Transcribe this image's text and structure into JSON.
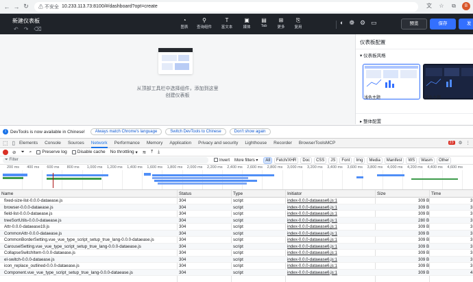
{
  "browser": {
    "security_label": "不安全",
    "url": "10.233.113.73:8100/#/dashboard?opt=create",
    "avatar_letter": "B"
  },
  "app": {
    "title": "新建仪表板",
    "tools": [
      {
        "icon": "chart-icon",
        "label": "图表"
      },
      {
        "icon": "query-icon",
        "label": "查询组件"
      },
      {
        "icon": "text-icon",
        "label": "富文本"
      },
      {
        "icon": "media-icon",
        "label": "媒体"
      },
      {
        "icon": "tab-icon",
        "label": "Tab"
      },
      {
        "icon": "more-icon",
        "label": "更多"
      },
      {
        "icon": "reuse-icon",
        "label": "复用"
      }
    ],
    "preview_label": "预览",
    "save_label": "保存",
    "publish_label": "发"
  },
  "canvas": {
    "hint_line1": "从顶部工具栏中选择组件，添加到这里",
    "hint_line2": "创建仪表板"
  },
  "panel": {
    "title": "仪表板配置",
    "section_style": "仪表板风格",
    "theme_light": "浅色主题",
    "theme_dark": "深色主题",
    "section_overall": "整体配置"
  },
  "devtools": {
    "banner_msg": "DevTools is now available in Chinese!",
    "banner_btn1": "Always match Chrome's language",
    "banner_btn2": "Switch DevTools to Chinese",
    "banner_btn3": "Don't show again",
    "tabs": [
      "Elements",
      "Console",
      "Sources",
      "Network",
      "Performance",
      "Memory",
      "Application",
      "Privacy and security",
      "Lighthouse",
      "Recorder",
      "BrowserToolsMCP"
    ],
    "active_tab": "Network",
    "error_count": "23",
    "preserve_log": "Preserve log",
    "disable_cache": "Disable cache",
    "throttling": "No throttling",
    "filter_placeholder": "Filter",
    "invert": "Invert",
    "more_filters": "More filters",
    "filter_types": [
      "All",
      "Fetch/XHR",
      "Doc",
      "CSS",
      "JS",
      "Font",
      "Img",
      "Media",
      "Manifest",
      "WS",
      "Wasm",
      "Other"
    ],
    "ticks": [
      "200 ms",
      "400 ms",
      "600 ms",
      "800 ms",
      "1,000 ms",
      "1,200 ms",
      "1,400 ms",
      "1,600 ms",
      "1,800 ms",
      "2,000 ms",
      "2,200 ms",
      "2,400 ms",
      "2,600 ms",
      "2,800 ms",
      "3,000 ms",
      "3,200 ms",
      "3,400 ms",
      "3,600 ms",
      "3,800 ms",
      "4,000 ms",
      "4,200 ms",
      "4,400 ms",
      "4,600 ms"
    ],
    "columns": {
      "name": "Name",
      "status": "Status",
      "type": "Type",
      "initiator": "Initiator",
      "size": "Size",
      "time": "Time"
    },
    "rows": [
      {
        "name": "fixed-size-list-0.0.0-dataease.js",
        "status": "304",
        "type": "script",
        "initiator": "index-0.0.0-dataease6.js:1",
        "size": "309 B",
        "time": "3"
      },
      {
        "name": "browser-0.0.0-dataease.js",
        "status": "304",
        "type": "script",
        "initiator": "index-0.0.0-dataease6.js:1",
        "size": "309 B",
        "time": "3"
      },
      {
        "name": "field-list-0.0.0-dataease.js",
        "status": "304",
        "type": "script",
        "initiator": "index-0.0.0-dataease6.js:1",
        "size": "309 B",
        "time": "3"
      },
      {
        "name": "treeSortUtils-0.0.0-dataease.js",
        "status": "304",
        "type": "script",
        "initiator": "index-0.0.0-dataease6.js:1",
        "size": "280 B",
        "time": "3"
      },
      {
        "name": "Attr-0.0.0-dataease19.js",
        "status": "304",
        "type": "script",
        "initiator": "index-0.0.0-dataease6.js:1",
        "size": "309 B",
        "time": "3"
      },
      {
        "name": "CommonAttr-0.0.0-dataease.js",
        "status": "304",
        "type": "script",
        "initiator": "index-0.0.0-dataease6.js:1",
        "size": "309 B",
        "time": "3"
      },
      {
        "name": "CommonBorderSetting.vue_vue_type_script_setup_true_lang-0.0.0-dataease.js",
        "status": "304",
        "type": "script",
        "initiator": "index-0.0.0-dataease6.js:1",
        "size": "309 B",
        "time": "3"
      },
      {
        "name": "CarouselSetting.vue_vue_type_script_setup_true_lang-0.0.0-dataease.js",
        "status": "304",
        "type": "script",
        "initiator": "index-0.0.0-dataease6.js:1",
        "size": "309 B",
        "time": "3"
      },
      {
        "name": "CollapseSwitchItem-0.0.0-dataease.js",
        "status": "304",
        "type": "script",
        "initiator": "index-0.0.0-dataease6.js:1",
        "size": "309 B",
        "time": "3"
      },
      {
        "name": "el-switch-0.0.0-dataease.js",
        "status": "304",
        "type": "script",
        "initiator": "index-0.0.0-dataease6.js:1",
        "size": "309 B",
        "time": "3"
      },
      {
        "name": "icon_replace_outlined-0.0.0-dataease.js",
        "status": "304",
        "type": "script",
        "initiator": "index-0.0.0-dataease6.js:1",
        "size": "309 B",
        "time": "3"
      },
      {
        "name": "Component.vue_vue_type_script_setup_true_lang-0.0.0-dataease.js",
        "status": "304",
        "type": "script",
        "initiator": "index-0.0.0-dataease6.js:1",
        "size": "309 B",
        "time": "4"
      }
    ]
  }
}
